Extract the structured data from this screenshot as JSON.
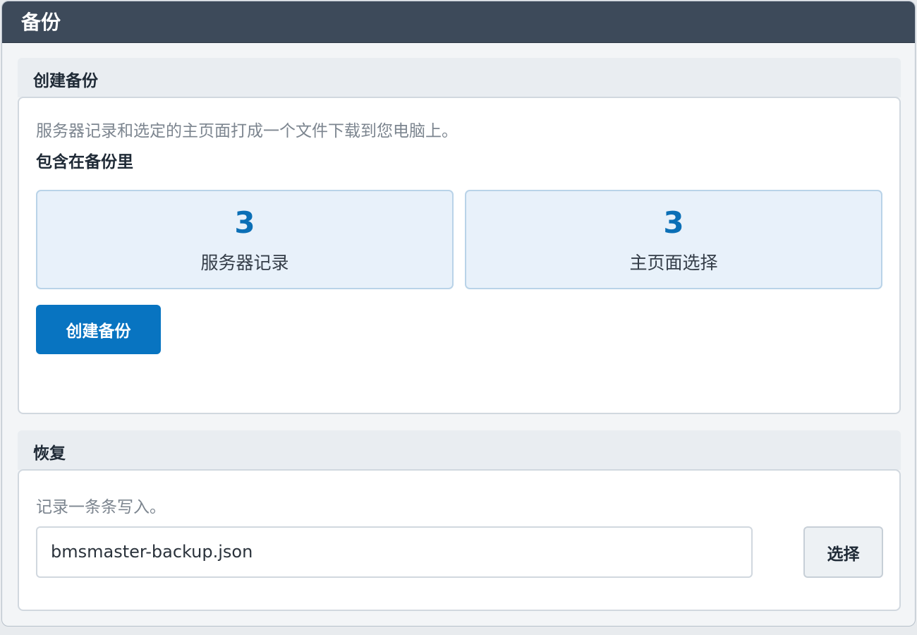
{
  "window": {
    "title": "备份"
  },
  "create_section": {
    "heading": "创建备份",
    "description": "服务器记录和选定的主页面打成一个文件下载到您电脑上。",
    "includes_heading": "包含在备份里",
    "stats": [
      {
        "value": "3",
        "label": "服务器记录"
      },
      {
        "value": "3",
        "label": "主页面选择"
      }
    ],
    "create_button_label": "创建备份"
  },
  "restore_section": {
    "heading": "恢复",
    "description": "记录一条条写入。",
    "file_value": "bmsmaster-backup.json",
    "choose_button_label": "选择"
  },
  "colors": {
    "titlebar": "#3d4a5a",
    "accent": "#0874c1",
    "stat_value": "#0b6fb6",
    "stat_background": "#e8f1fa"
  }
}
